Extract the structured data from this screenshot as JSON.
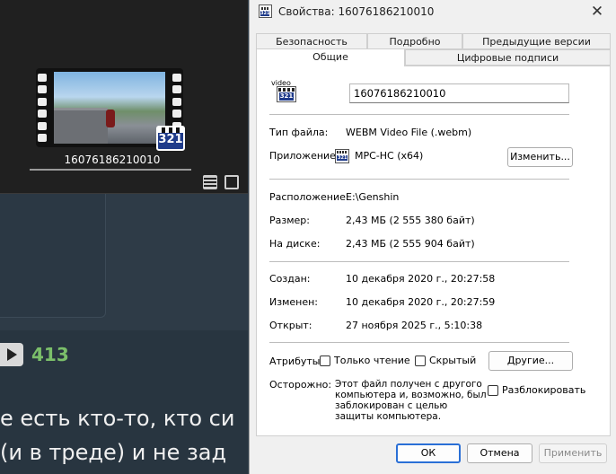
{
  "background": {
    "thumbnail_name": "16076186210010",
    "vote_count": "413",
    "text_line1": "е есть кто-то, кто си",
    "text_line2": "(и в треде) и не зад"
  },
  "dialog": {
    "title": "Свойства: 16076186210010",
    "tabs_row1": [
      "Безопасность",
      "Подробно",
      "Предыдущие версии"
    ],
    "tabs_row2": [
      "Общие",
      "Цифровые подписи"
    ],
    "active_tab": "Общие",
    "file_name": "16076186210010",
    "icon_label": "video",
    "icon_number": "321",
    "file_type_label": "Тип файла:",
    "file_type_value": "WEBM Video File (.webm)",
    "app_label": "Приложение:",
    "app_value": "MPC-HC (x64)",
    "change_button": "Изменить...",
    "location_label": "Расположение:",
    "location_value": "E:\\Genshin",
    "size_label": "Размер:",
    "size_value": "2,43 МБ (2 555 380 байт)",
    "disk_label": "На диске:",
    "disk_value": "2,43 МБ (2 555 904 байт)",
    "created_label": "Создан:",
    "created_value": "10 декабря 2020 г., 20:27:58",
    "modified_label": "Изменен:",
    "modified_value": "10 декабря 2020 г., 20:27:59",
    "opened_label": "Открыт:",
    "opened_value": "27 ноября 2025 г., 5:10:38",
    "attributes_label": "Атрибуты:",
    "readonly_label": "Только чтение",
    "hidden_label": "Скрытый",
    "other_button": "Другие...",
    "caution_label": "Осторожно:",
    "caution_text": "Этот файл получен с другого компьютера и, возможно, был заблокирован с целью защиты компьютера.",
    "unblock_label": "Разблокировать",
    "ok_button": "ОК",
    "cancel_button": "Отмена",
    "apply_button": "Применить"
  }
}
